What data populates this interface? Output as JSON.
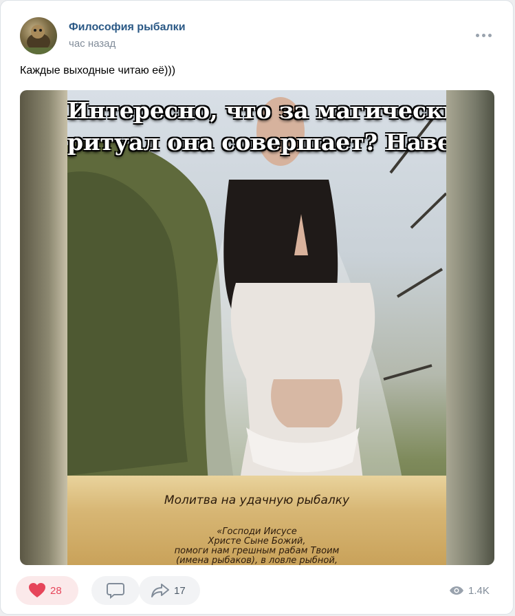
{
  "post": {
    "group_name": "Философия рыбалки",
    "time": "час назад",
    "text": "Каждые выходные читаю её)))"
  },
  "photo": {
    "caption_line1": "Интересно, что за магический",
    "caption_line2": "ритуал она совершает? Наверно...",
    "scroll_title": "Молитва на удачную рыбалку",
    "scroll_text": "«Господи Иисусе\nХристе Сыне Божий,\nпомоги нам грешным рабам Твоим\n(имена рыбаков), в ловле рыбной,"
  },
  "actions": {
    "likes": "28",
    "shares": "17",
    "views": "1.4K"
  },
  "colors": {
    "link": "#2a5885",
    "secondary": "#818c99",
    "like": "#e6455a",
    "pill_bg": "#f2f3f5"
  },
  "icons": [
    "more-icon",
    "heart-icon",
    "comment-icon",
    "share-icon",
    "eye-icon"
  ]
}
